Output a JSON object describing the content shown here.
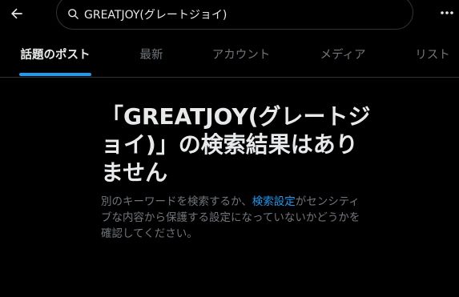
{
  "header": {
    "search_value": "GREATJOY(グレートジョイ)"
  },
  "tabs": [
    {
      "label": "話題のポスト",
      "active": true
    },
    {
      "label": "最新",
      "active": false
    },
    {
      "label": "アカウント",
      "active": false
    },
    {
      "label": "メディア",
      "active": false
    },
    {
      "label": "リスト",
      "active": false
    }
  ],
  "empty_state": {
    "title": "「GREATJOY(グレートジョイ)」の検索結果はありません",
    "description_before": "別のキーワードを検索するか、",
    "settings_link": "検索設定",
    "description_after": "がセンシティブな内容から保護する設定になっていないかどうかを確認してください。"
  },
  "colors": {
    "background": "#000000",
    "accent": "#1d9bf0",
    "text_primary": "#e7e9ea",
    "text_secondary": "#71767b",
    "border": "#2f3336"
  },
  "icons": {
    "back": "arrow-left-icon",
    "search": "search-icon",
    "more": "more-horizontal-icon"
  }
}
